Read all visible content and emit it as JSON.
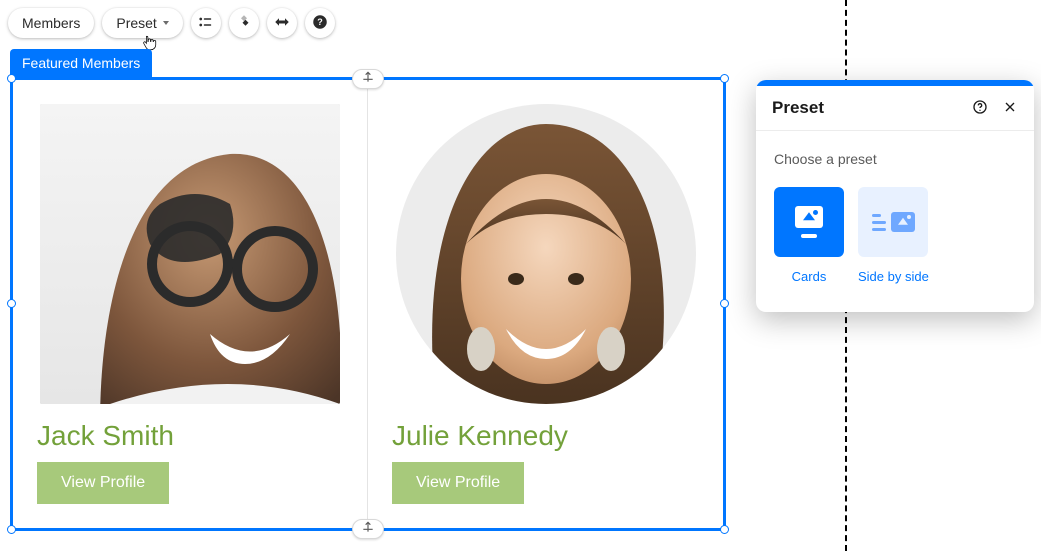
{
  "toolbar": {
    "members_label": "Members",
    "preset_label": "Preset"
  },
  "tag_label": "Featured Members",
  "members": [
    {
      "name": "Jack Smith",
      "view_label": "View Profile"
    },
    {
      "name": "Julie Kennedy",
      "view_label": "View Profile"
    }
  ],
  "panel": {
    "title": "Preset",
    "subtitle": "Choose a preset",
    "options": [
      {
        "label": "Cards",
        "selected": true
      },
      {
        "label": "Side by side",
        "selected": false
      }
    ]
  },
  "colors": {
    "accent": "#0076ff",
    "name_green": "#73a13a",
    "button_green": "#a7c97b"
  }
}
